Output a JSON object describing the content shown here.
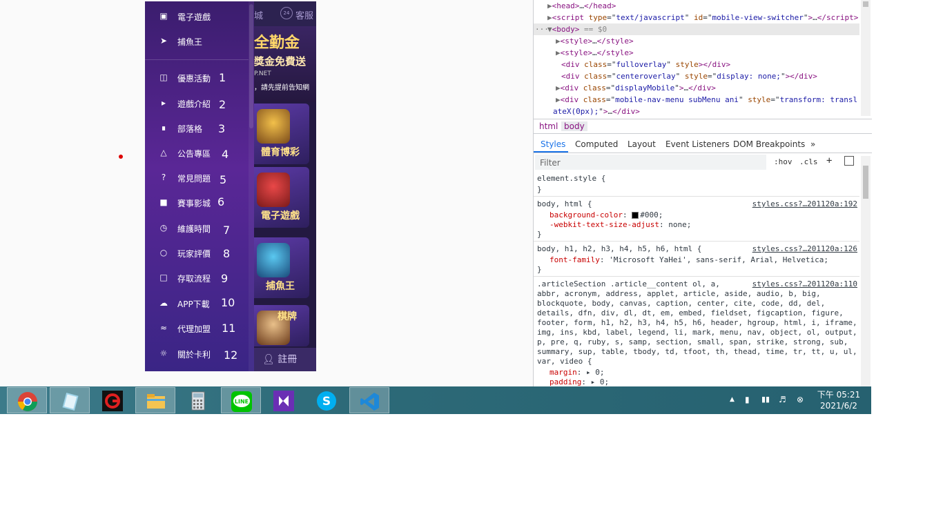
{
  "menu": {
    "top_items": [
      {
        "label": "電子遊戲",
        "icon": "slot-machine-icon"
      },
      {
        "label": "捕魚王",
        "icon": "fish-icon"
      }
    ],
    "items": [
      {
        "label": "優惠活動",
        "icon": "gift-icon",
        "num": "1"
      },
      {
        "label": "遊戲介紹",
        "icon": "megaphone-icon",
        "num": "2"
      },
      {
        "label": "部落格",
        "icon": "blog-icon",
        "num": "3"
      },
      {
        "label": "公告專區",
        "icon": "bell-icon",
        "num": "4"
      },
      {
        "label": "常見問題",
        "icon": "question-icon",
        "num": "5"
      },
      {
        "label": "賽事影城",
        "icon": "video-camera-icon",
        "num": "6"
      },
      {
        "label": "維護時間",
        "icon": "clock-icon",
        "num": "7"
      },
      {
        "label": "玩家評價",
        "icon": "medal-icon",
        "num": "8"
      },
      {
        "label": "存取流程",
        "icon": "wallet-icon",
        "num": "9"
      },
      {
        "label": "APP下載",
        "icon": "cloud-download-icon",
        "num": "10"
      },
      {
        "label": "代理加盟",
        "icon": "handshake-icon",
        "num": "11"
      },
      {
        "label": "關於卡利",
        "icon": "brain-icon",
        "num": "12"
      }
    ]
  },
  "site": {
    "top_left": "城",
    "top_badge": "24",
    "top_right": "客服",
    "banner_title": "全勤金",
    "banner_sub": "獎金免費送",
    "banner_url": "P.NET",
    "banner_note": "，請先提前告知網",
    "cards": [
      "體育博彩",
      "電子遊戲",
      "捕魚王",
      "棋牌"
    ],
    "register": "註冊"
  },
  "devtools": {
    "elements": [
      {
        "tw": "▶",
        "html": "<span class='tag'>&lt;head&gt;</span>…<span class='tag'>&lt;/head&gt;</span>"
      },
      {
        "tw": "▶",
        "html": "<span class='tag'>&lt;script</span> <span class='an'>type</span>=\"<span class='av'>text/javascript</span>\" <span class='an'>id</span>=\"<span class='av'>mobile-view-switcher</span>\"<span class='tag'>&gt;</span>…<span class='tag'>&lt;/script&gt;</span>"
      },
      {
        "tw": "▼",
        "html": "<span class='tag'>&lt;body&gt;</span> <span class='eq'>== $0</span>",
        "sel": true
      },
      {
        "tw": "▶",
        "html": "<span class='tag'>&lt;style&gt;</span>…<span class='tag'>&lt;/style&gt;</span>"
      },
      {
        "tw": "▶",
        "html": "<span class='tag'>&lt;style&gt;</span>…<span class='tag'>&lt;/style&gt;</span>"
      },
      {
        "tw": "",
        "html": "<span class='tag'>&lt;div</span> <span class='an'>class</span>=\"<span class='av'>fulloverlay</span>\" <span class='an'>style</span><span class='tag'>&gt;&lt;/div&gt;</span>"
      },
      {
        "tw": "",
        "html": "<span class='tag'>&lt;div</span> <span class='an'>class</span>=\"<span class='av'>centeroverlay</span>\" <span class='an'>style</span>=\"<span class='av'>display: none;</span>\"<span class='tag'>&gt;&lt;/div&gt;</span>"
      },
      {
        "tw": "▶",
        "html": "<span class='tag'>&lt;div</span> <span class='an'>class</span>=\"<span class='av'>displayMobile</span>\"<span class='tag'>&gt;</span>…<span class='tag'>&lt;/div&gt;</span>"
      },
      {
        "tw": "▶",
        "html": "<span class='tag'>&lt;div</span> <span class='an'>class</span>=\"<span class='av'>mobile-nav-menu subMenu ani</span>\" <span class='an'>style</span>=\"<span class='av'>transform: transl</span>"
      },
      {
        "tw": "",
        "html": "<span class='av'>ateX(0px);</span>\"<span class='tag'>&gt;</span>…<span class='tag'>&lt;/div&gt;</span>"
      }
    ],
    "breadcrumb": [
      "html",
      "body"
    ],
    "tabs": [
      "Styles",
      "Computed",
      "Layout",
      "Event Listeners",
      "DOM Breakpoints",
      "»"
    ],
    "filter_placeholder": "Filter",
    "hov": ":hov",
    "cls": ".cls",
    "plus": "+",
    "element_style": "element.style {",
    "close_brace": "}",
    "rule1_sel": "body, html {",
    "rule1_src": "styles.css?…201120a:192",
    "rule1_p1": "background-color",
    "rule1_v1": "#000;",
    "rule1_p2": "-webkit-text-size-adjust",
    "rule1_v2": "none;",
    "rule2_sel": "body, h1, h2, h3, h4, h5, h6, html {",
    "rule2_src": "styles.css?…201120a:126",
    "rule2_p1": "font-family",
    "rule2_v1": "'Microsoft YaHei', sans-serif, Arial, Helvetica;",
    "rule3_src": "styles.css?…201120a:110",
    "rule3_lines": [
      ".articleSection .article__content ol, a,",
      "abbr, acronym, address, applet, article, aside, audio, b, big,",
      "blockquote, body, canvas, caption, center, cite, code, dd, del,",
      "details, dfn, div, dl, dt, em, embed, fieldset, figcaption, figure,",
      "footer, form, h1, h2, h3, h4, h5, h6, header, hgroup, html, i, iframe,",
      "img, ins, kbd, label, legend, li, mark, menu, nav, object, ol, output,",
      "p, pre, q, ruby, s, samp, section, small, span, strike, strong, sub,",
      "summary, sup, table, tbody, td, tfoot, th, thead, time, tr, tt, u, ul,",
      "var, video {"
    ],
    "rule3_p1": "margin",
    "rule3_v1": "0;",
    "rule3_p2": "padding",
    "rule3_v2": "0;"
  },
  "taskbar": {
    "apps": [
      "chrome-icon",
      "notepad-icon",
      "garena-icon",
      "file-explorer-icon",
      "calculator-icon",
      "line-icon",
      "visual-studio-icon",
      "skype-icon",
      "vscode-icon"
    ],
    "line_label": "LINE",
    "time": "下午 05:21",
    "date": "2021/6/2"
  }
}
